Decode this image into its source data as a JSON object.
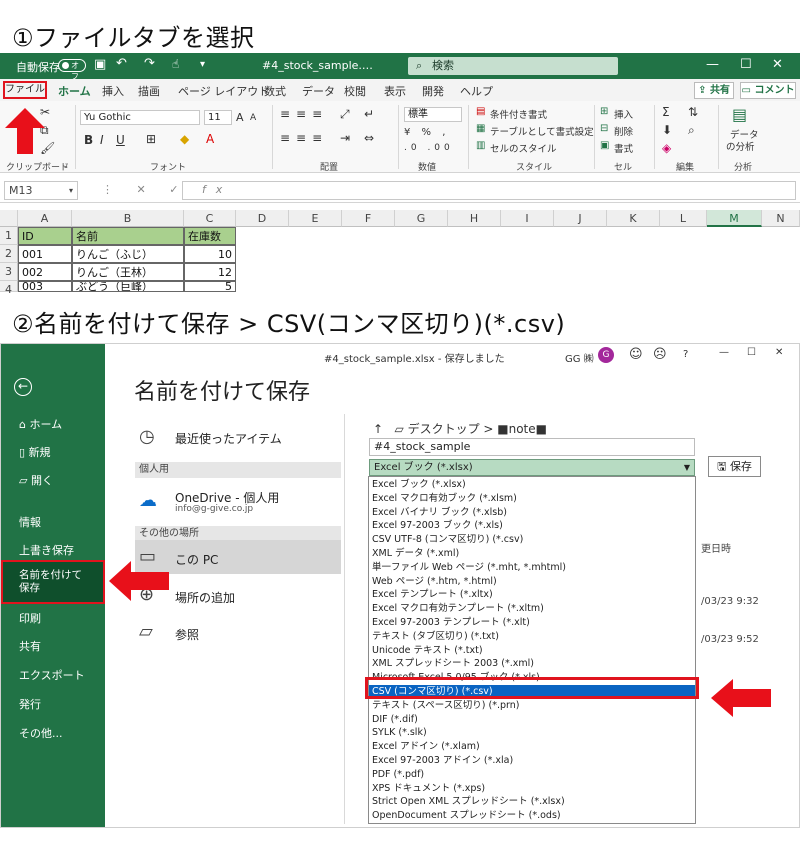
{
  "step1": {
    "title": "①ファイルタブを選択"
  },
  "step2": {
    "title": "②名前を付けて保存 > CSV(コンマ区切り)(*.csv)"
  },
  "excel": {
    "autosave_label": "自動保存",
    "autosave_state": "オフ",
    "doc_title": "#4_stock_sample.…",
    "search_placeholder": "検索",
    "tabs": [
      "ファイル",
      "ホーム",
      "挿入",
      "描画",
      "ページ レイアウト",
      "数式",
      "データ",
      "校閲",
      "表示",
      "開発",
      "ヘルプ"
    ],
    "share_label": "共有",
    "comment_label": "コメント",
    "font_name": "Yu Gothic",
    "font_size": "11",
    "number_format": "標準",
    "groups": [
      "クリップボード",
      "フォント",
      "配置",
      "数値",
      "スタイル",
      "セル",
      "編集",
      "分析"
    ],
    "styles_items": [
      "条件付き書式",
      "テーブルとして書式設定",
      "セルのスタイル"
    ],
    "cells_items": [
      "挿入",
      "削除",
      "書式"
    ],
    "analysis_items": [
      "データ",
      "の分析"
    ],
    "name_box": "M13",
    "columns": [
      "A",
      "B",
      "C",
      "D",
      "E",
      "F",
      "G",
      "H",
      "I",
      "J",
      "K",
      "L",
      "M",
      "N"
    ],
    "rows": [
      "1",
      "2",
      "3",
      "4"
    ],
    "cells": [
      [
        "ID",
        "名前",
        "在庫数"
      ],
      [
        "001",
        "りんご（ふじ）",
        "10"
      ],
      [
        "002",
        "りんご（王林）",
        "12"
      ],
      [
        "003",
        "ぶどう（巨峰）",
        "5"
      ]
    ],
    "colors": {
      "accent": "#217346",
      "header_fill": "#a9d08e",
      "highlight": "#e0141e"
    }
  },
  "backstage": {
    "window_title": "#4_stock_sample.xlsx - 保存しました",
    "user": "GG ㈱",
    "avatar": "G",
    "help": "?",
    "heading": "名前を付けて保存",
    "nav": [
      "ホーム",
      "新規",
      "開く",
      "情報",
      "上書き保存",
      "名前を付けて保存",
      "印刷",
      "共有",
      "エクスポート",
      "発行",
      "その他..."
    ],
    "recent": "最近使ったアイテム",
    "personal_section": "個人用",
    "onedrive": "OneDrive - 個人用",
    "onedrive_email": "info@g-give.co.jp",
    "other_section": "その他の場所",
    "this_pc": "この PC",
    "add_place": "場所の追加",
    "browse": "参照",
    "path": "デスクトップ >  ■note■",
    "filename": "#4_stock_sample",
    "filetype_selected": "Excel ブック (*.xlsx)",
    "save_button": "保存",
    "date_header": "更日時",
    "dates": [
      "/03/23 9:32",
      "/03/23 9:52"
    ],
    "filetypes": [
      "Excel ブック (*.xlsx)",
      "Excel マクロ有効ブック (*.xlsm)",
      "Excel バイナリ ブック (*.xlsb)",
      "Excel 97-2003 ブック (*.xls)",
      "CSV UTF-8 (コンマ区切り) (*.csv)",
      "XML データ (*.xml)",
      "単一ファイル Web ページ (*.mht, *.mhtml)",
      "Web ページ (*.htm, *.html)",
      "Excel テンプレート (*.xltx)",
      "Excel マクロ有効テンプレート (*.xltm)",
      "Excel 97-2003 テンプレート (*.xlt)",
      "テキスト (タブ区切り) (*.txt)",
      "Unicode テキスト (*.txt)",
      "XML スプレッドシート 2003 (*.xml)",
      "Microsoft Excel 5.0/95 ブック (*.xls)",
      "CSV (コンマ区切り) (*.csv)",
      "テキスト (スペース区切り) (*.prn)",
      "DIF (*.dif)",
      "SYLK (*.slk)",
      "Excel アドイン (*.xlam)",
      "Excel 97-2003 アドイン (*.xla)",
      "PDF (*.pdf)",
      "XPS ドキュメント (*.xps)",
      "Strict Open XML スプレッドシート (*.xlsx)",
      "OpenDocument スプレッドシート (*.ods)"
    ],
    "highlighted_index": 15
  }
}
